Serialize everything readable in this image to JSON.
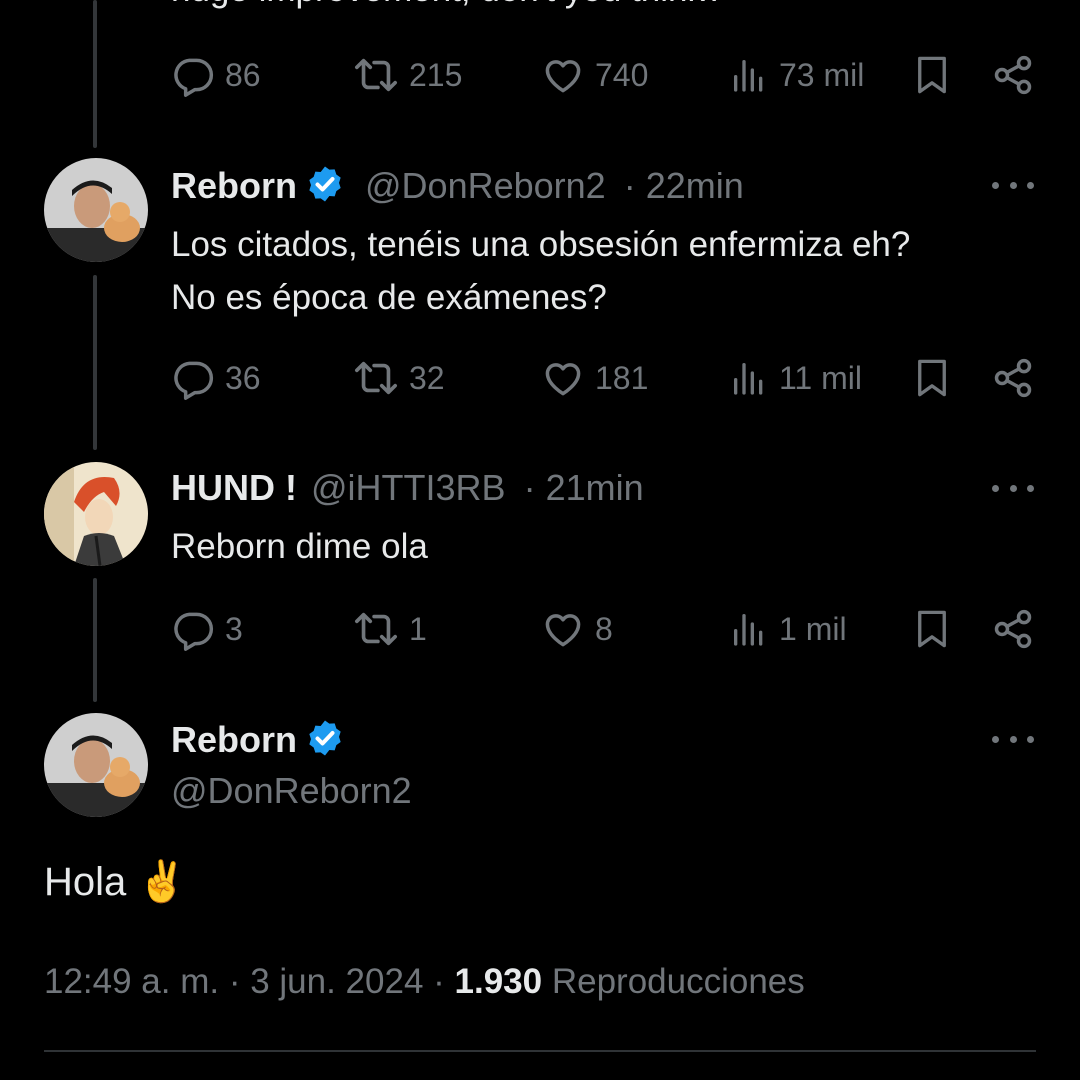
{
  "top_tweet": {
    "text_fragment": "huge improvement, don't you think?",
    "replies": "86",
    "retweets": "215",
    "likes": "740",
    "views": "73 mil"
  },
  "reply1": {
    "name": "Reborn",
    "handle": "@DonReborn2",
    "time": "· 22min",
    "text_line1": "Los citados, tenéis una obsesión enfermiza eh?",
    "text_line2": "No es época de exámenes?",
    "replies": "36",
    "retweets": "32",
    "likes": "181",
    "views": "11 mil"
  },
  "reply2": {
    "name": "HUND !",
    "handle": "@iHTTI3RB",
    "time": "· 21min",
    "text": "Reborn dime ola",
    "replies": "3",
    "retweets": "1",
    "likes": "8",
    "views": "1 mil"
  },
  "main_tweet": {
    "name": "Reborn",
    "handle": "@DonReborn2",
    "text": "Hola ✌️",
    "time": "12:49 a. m. · 3 jun. 2024 · ",
    "views": "1.930",
    "views_label": " Reproducciones"
  },
  "colors": {
    "verified": "#1d9bf0",
    "muted": "#71767b",
    "text": "#e7e9ea",
    "background": "#000000"
  },
  "icons": [
    "reply-icon",
    "retweet-icon",
    "like-icon",
    "views-icon",
    "bookmark-icon",
    "share-icon",
    "verified-badge-icon",
    "more-icon"
  ]
}
